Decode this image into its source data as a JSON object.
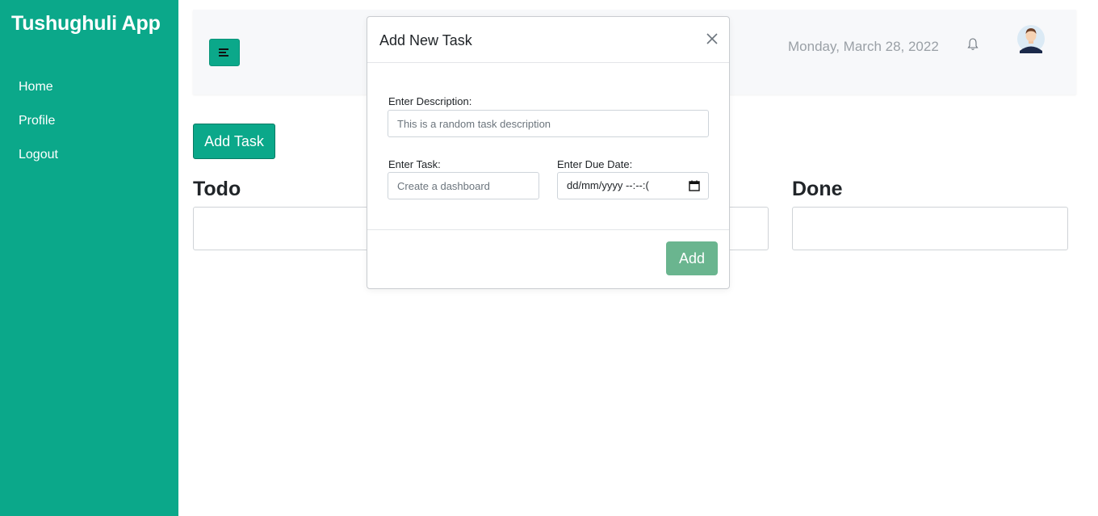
{
  "app": {
    "brand": "Tushughuli App"
  },
  "sidebar": {
    "items": [
      {
        "label": "Home"
      },
      {
        "label": "Profile"
      },
      {
        "label": "Logout"
      }
    ]
  },
  "header": {
    "date": "Monday, March 28, 2022",
    "icons": [
      "menu-toggle-icon",
      "bell-icon",
      "avatar"
    ]
  },
  "main": {
    "add_task_label": "Add Task",
    "columns": [
      {
        "title": "Todo"
      },
      {
        "title": ""
      },
      {
        "title": "Done"
      }
    ]
  },
  "modal": {
    "title": "Add New Task",
    "description_label": "Enter Description:",
    "description_placeholder": "This is a random task description",
    "task_label": "Enter Task:",
    "task_placeholder": "Create a dashboard",
    "due_label": "Enter Due Date:",
    "due_placeholder": "dd/mm/yyyy --:--:(",
    "submit_label": "Add"
  },
  "colors": {
    "sidebar": "#0ba88a",
    "submit": "#6ab58f"
  }
}
